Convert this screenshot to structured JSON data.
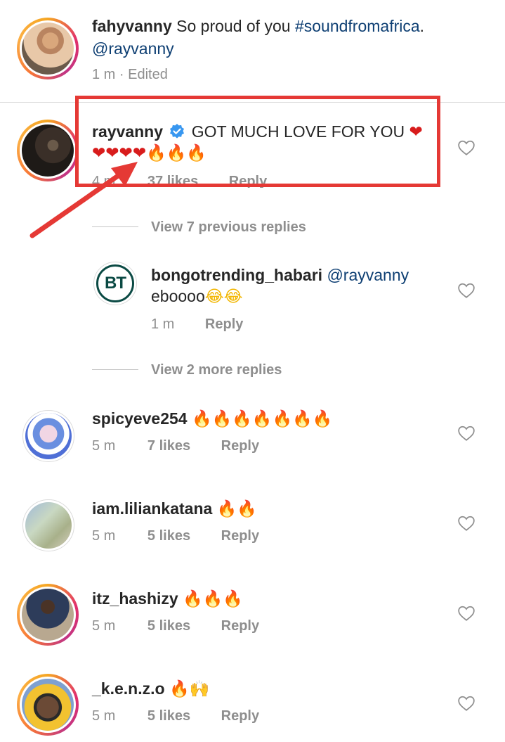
{
  "comments": [
    {
      "username": "fahyvanny",
      "text": "So proud of you",
      "hashtag": "#soundfromafrica",
      "trail": ".",
      "mention": "@rayvanny",
      "time": "1 m",
      "edited": "· Edited"
    },
    {
      "username": "rayvanny",
      "verified": true,
      "text": "GOT MUCH LOVE FOR YOU",
      "emojis_line1": "❤",
      "emojis_line2_hearts": "❤❤❤❤",
      "emojis_line2_fire": "🔥🔥🔥",
      "time": "4 m",
      "likes": "37 likes",
      "reply": "Reply",
      "highlight_color": "#e53935"
    },
    {
      "view_previous": "View 7 previous replies"
    },
    {
      "username": "bongotrending_habari",
      "mention": "@rayvanny",
      "text": "eboooo",
      "emojis": "😂😂",
      "avatar_text": "BT",
      "time": "1 m",
      "reply": "Reply"
    },
    {
      "view_more": "View 2 more replies"
    },
    {
      "username": "spicyeve254",
      "emojis": "🔥🔥🔥🔥🔥🔥🔥",
      "time": "5 m",
      "likes": "7 likes",
      "reply": "Reply"
    },
    {
      "username": "iam.liliankatana",
      "emojis": "🔥🔥",
      "time": "5 m",
      "likes": "5 likes",
      "reply": "Reply"
    },
    {
      "username": "itz_hashizy",
      "emojis": "🔥🔥🔥",
      "time": "5 m",
      "likes": "5 likes",
      "reply": "Reply"
    },
    {
      "username": "_k.e.n.z.o",
      "emojis": "🔥🙌",
      "time": "5 m",
      "likes": "5 likes",
      "reply": "Reply"
    }
  ],
  "icons": {
    "like": "heart-outline-icon",
    "verified": "verified-badge-icon",
    "arrow": "red-arrow-annotation"
  }
}
